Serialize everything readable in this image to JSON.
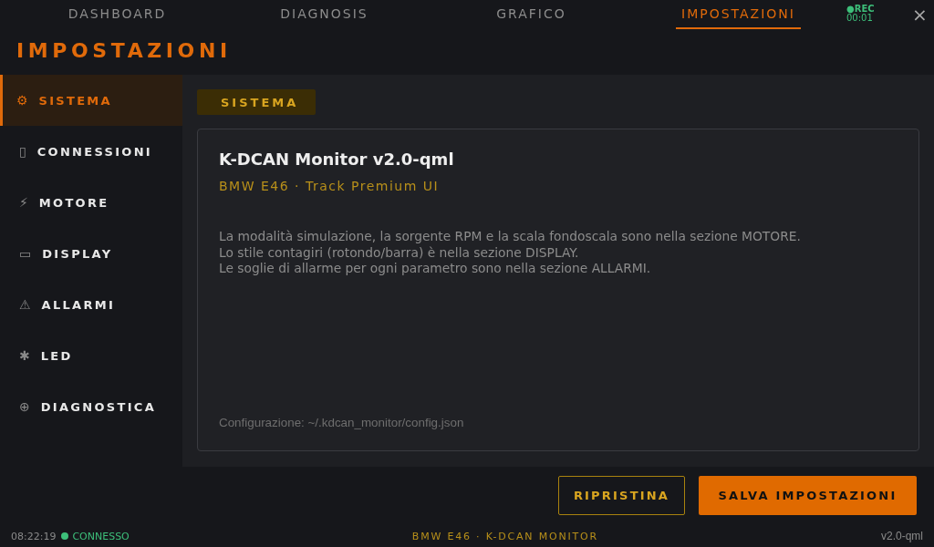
{
  "tabs": [
    {
      "label": "DASHBOARD",
      "selected": false
    },
    {
      "label": "DIAGNOSIS",
      "selected": false
    },
    {
      "label": "GRAFICO",
      "selected": false
    },
    {
      "label": "IMPOSTAZIONI",
      "selected": true
    }
  ],
  "recording": {
    "label": "●REC",
    "time": "00:01"
  },
  "close_button": {
    "label": "×"
  },
  "page_title": "IMPOSTAZIONI",
  "sidebar": {
    "items": [
      {
        "icon": "⚙",
        "label": "SISTEMA",
        "selected": true
      },
      {
        "icon": "▯",
        "label": "CONNESSIONI",
        "selected": false
      },
      {
        "icon": "⚡",
        "label": "MOTORE",
        "selected": false
      },
      {
        "icon": "▭",
        "label": "DISPLAY",
        "selected": false
      },
      {
        "icon": "⚠",
        "label": "ALLARMI",
        "selected": false
      },
      {
        "icon": "✱",
        "label": "LED",
        "selected": false
      },
      {
        "icon": "⊕",
        "label": "DIAGNOSTICA",
        "selected": false
      }
    ]
  },
  "section": {
    "badge": "SISTEMA",
    "card": {
      "title": "K-DCAN Monitor v2.0-qml",
      "subtitle": "BMW E46 · Track Premium UI",
      "description": [
        "La modalità simulazione, la sorgente RPM e la scala fondoscala sono nella sezione MOTORE.",
        "Lo stile contagiri (rotondo/barra) è nella sezione DISPLAY.",
        "Le soglie di allarme per ogni parametro sono nella sezione ALLARMI."
      ],
      "config_path": "Configurazione: ~/.kdcan_monitor/config.json"
    }
  },
  "buttons": [
    {
      "label": "RIPRISTINA",
      "kind": "secondary"
    },
    {
      "label": "SALVA IMPOSTAZIONI",
      "kind": "primary"
    }
  ],
  "status_bar": {
    "time": "08:22:19",
    "connection": "CONNESSO",
    "connected": true,
    "center": "BMW E46 · K-DCAN MONITOR",
    "version": "v2.0-qml"
  }
}
